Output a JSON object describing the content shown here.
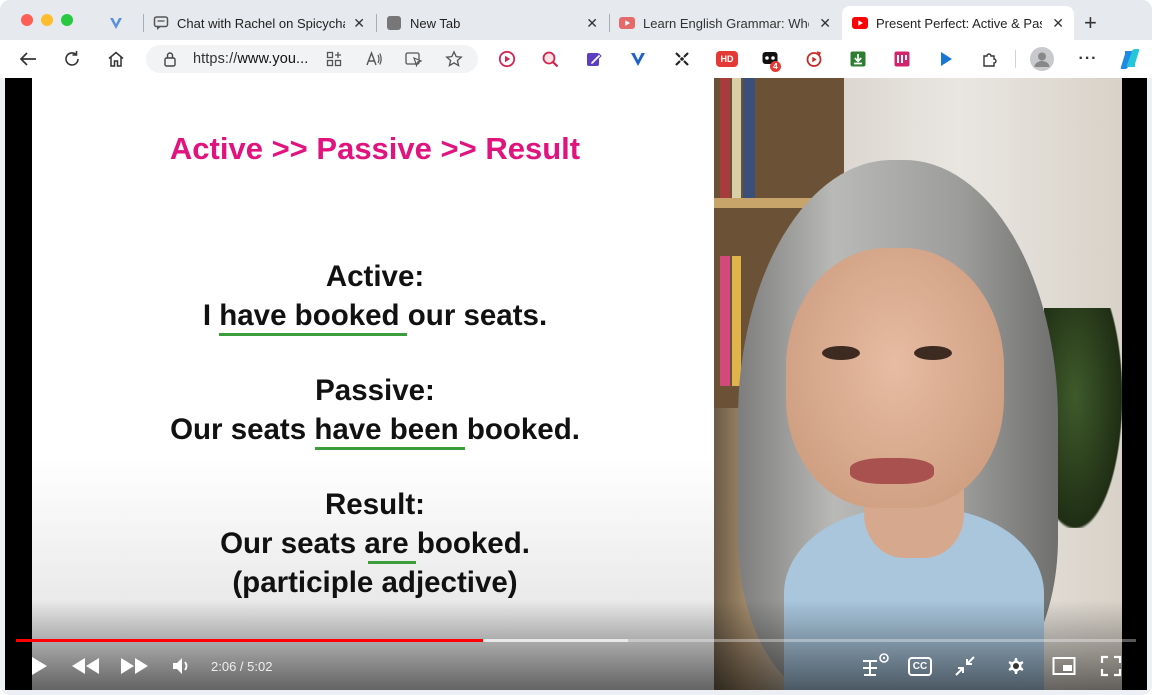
{
  "browser": {
    "tabs": [
      {
        "title": "",
        "icon": "vivaldi-v-icon",
        "active": false
      },
      {
        "title": "Chat with Rachel on Spicychat",
        "icon": "chat-bubble-icon",
        "active": false
      },
      {
        "title": "New Tab",
        "icon": "new-tab-page-icon",
        "active": false
      },
      {
        "title": "Learn English Grammar: When",
        "icon": "youtube-icon",
        "active": false
      },
      {
        "title": "Present Perfect: Active & Passive",
        "icon": "youtube-icon",
        "active": true
      }
    ],
    "new_tab_symbol": "+",
    "url_prefix": "https://",
    "url_host": "www.you...",
    "extension_badge": "4",
    "hd_label": "HD"
  },
  "video": {
    "slide": {
      "title": "Active >> Passive >> Result",
      "active_heading": "Active:",
      "active_sentence": "I have booked our seats.",
      "passive_heading": "Passive:",
      "passive_sentence": "Our seats have been booked.",
      "result_heading": "Result:",
      "result_sentence": "Our seats are booked.",
      "result_note": "(participle adjective)"
    },
    "time_current": "2:06",
    "time_total": "5:02",
    "time_display": "2:06 / 5:02",
    "progress_fraction": 0.417,
    "buffered_fraction": 0.546,
    "cc_label": "CC",
    "colors": {
      "title": "#e0137f",
      "underline": "#3a9f3a",
      "progress": "#ff0000"
    }
  }
}
